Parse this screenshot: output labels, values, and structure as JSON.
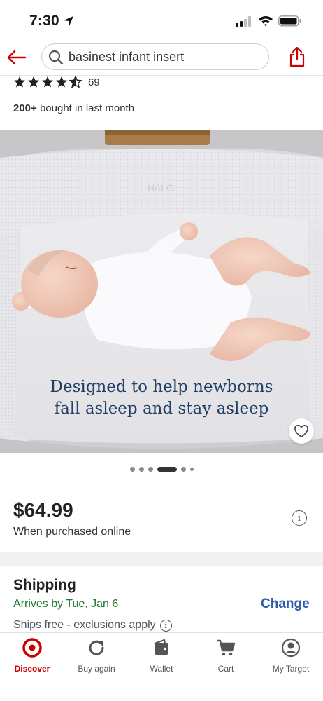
{
  "status_bar": {
    "time": "7:30"
  },
  "search": {
    "query": "basinest infant insert"
  },
  "rating": {
    "stars": 4.5,
    "count": "69"
  },
  "bought": {
    "bold": "200+",
    "rest": " bought in last month"
  },
  "hero": {
    "caption_line1": "Designed to help newborns",
    "caption_line2": "fall asleep and stay asleep",
    "image_text": "HALO"
  },
  "carousel": {
    "total": 6,
    "active_index": 3
  },
  "price": {
    "amount": "$64.99",
    "subtitle": "When purchased online"
  },
  "shipping": {
    "title": "Shipping",
    "arrival": "Arrives by Tue, Jan 6",
    "change_label": "Change",
    "free_note": "Ships free - exclusions apply"
  },
  "nav": {
    "discover": "Discover",
    "buy_again": "Buy again",
    "wallet": "Wallet",
    "cart": "Cart",
    "my_target": "My Target"
  },
  "colors": {
    "brand_red": "#cc0000",
    "arrival_green": "#1d7a2a",
    "link_blue": "#2f5aa8",
    "caption_navy": "#1f3f66"
  },
  "icons": {
    "back": "arrow-left-icon",
    "search": "search-icon",
    "share": "share-icon",
    "favorite": "heart-icon",
    "info": "info-icon",
    "discover": "target-bullseye-icon",
    "buy_again": "refresh-icon",
    "wallet": "wallet-icon",
    "cart": "cart-icon",
    "my_target": "user-icon"
  }
}
